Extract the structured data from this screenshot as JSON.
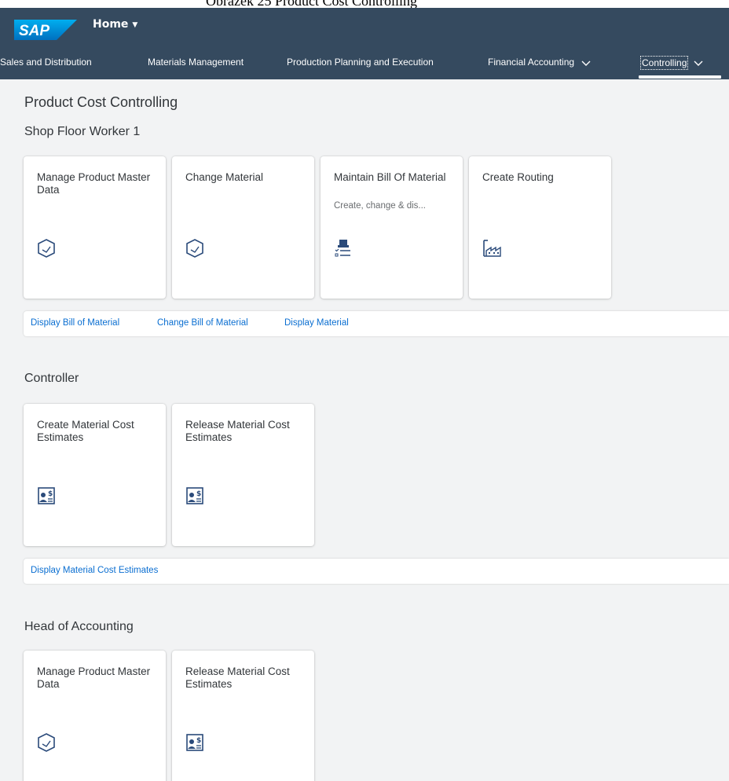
{
  "caption": "Obrázek 25 Product Cost Controlling",
  "shell": {
    "logo_text": "SAP",
    "home_title": "Home",
    "brand_color": "#354a5f"
  },
  "nav": {
    "items": [
      {
        "label": "Sales and Distribution"
      },
      {
        "label": "Materials Management"
      },
      {
        "label": "Production Planning and Execution"
      },
      {
        "label": "Financial Accounting"
      },
      {
        "label": "Controlling",
        "active": true
      }
    ]
  },
  "page": {
    "title": "Product Cost Controlling"
  },
  "groups": [
    {
      "title": "Shop Floor Worker 1",
      "tiles": [
        {
          "title": "Manage Product Master Data",
          "subtitle": "",
          "icon": "product-icon"
        },
        {
          "title": "Change Material",
          "subtitle": "",
          "icon": "product-icon"
        },
        {
          "title": "Maintain Bill Of Material",
          "subtitle": "Create, change & dis...",
          "icon": "bom-list-icon"
        },
        {
          "title": "Create Routing",
          "subtitle": "",
          "icon": "factory-icon"
        }
      ],
      "links": [
        "Display Bill of Material",
        "Change Bill of Material",
        "Display Material"
      ]
    },
    {
      "title": "Controller",
      "tiles": [
        {
          "title": "Create Material Cost Estimates",
          "subtitle": "",
          "icon": "cost-estimate-icon"
        },
        {
          "title": "Release Material Cost Estimates",
          "subtitle": "",
          "icon": "cost-estimate-icon"
        }
      ],
      "links": [
        "Display Material Cost Estimates"
      ]
    },
    {
      "title": "Head of Accounting",
      "tiles": [
        {
          "title": "Manage Product Master Data",
          "subtitle": "",
          "icon": "product-icon"
        },
        {
          "title": "Release Material Cost Estimates",
          "subtitle": "",
          "icon": "cost-estimate-icon"
        }
      ],
      "links": []
    }
  ]
}
